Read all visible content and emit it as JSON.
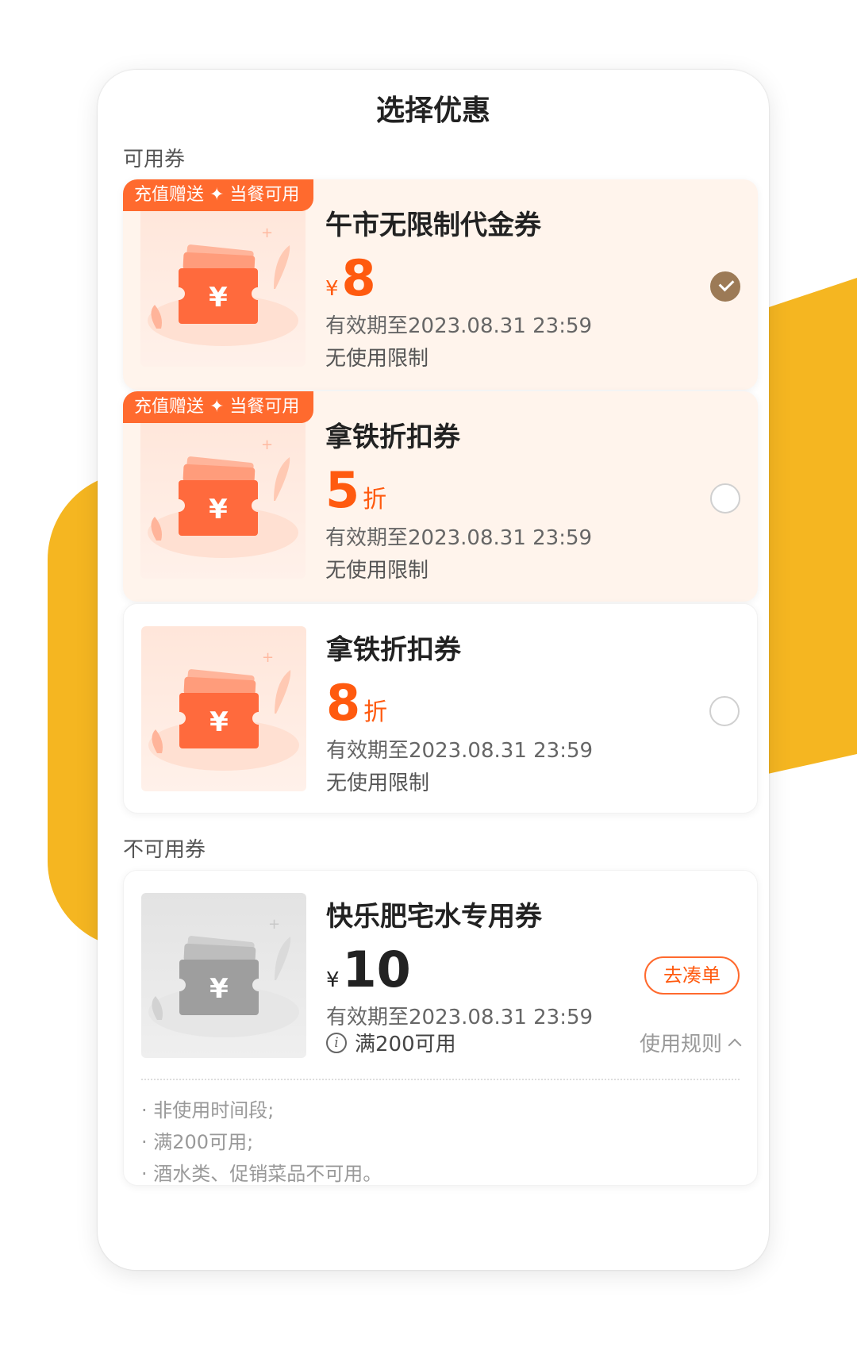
{
  "page": {
    "title": "选择优惠"
  },
  "available_section": {
    "label": "可用券",
    "coupons": [
      {
        "tag": "充值赠送 ✦ 当餐可用",
        "title": "午市无限制代金券",
        "currency": "¥",
        "amount": "8",
        "unit": "",
        "expire": "有效期至2023.08.31 23:59",
        "limit": "无使用限制",
        "selected": true
      },
      {
        "tag": "充值赠送 ✦ 当餐可用",
        "title": "拿铁折扣券",
        "currency": "",
        "amount": "5",
        "unit": "折",
        "expire": "有效期至2023.08.31 23:59",
        "limit": "无使用限制",
        "selected": false
      },
      {
        "tag": "",
        "title": "拿铁折扣券",
        "currency": "",
        "amount": "8",
        "unit": "折",
        "expire": "有效期至2023.08.31 23:59",
        "limit": "无使用限制",
        "selected": false
      }
    ]
  },
  "unavailable_section": {
    "label": "不可用券",
    "coupon": {
      "title": "快乐肥宅水专用券",
      "currency": "¥",
      "amount": "10",
      "expire": "有效期至2023.08.31 23:59",
      "condition": "满200可用",
      "action_label": "去凑单",
      "rules_label": "使用规则",
      "rules": [
        "非使用时间段;",
        "满200可用;",
        "酒水类、促销菜品不可用。"
      ]
    }
  },
  "colors": {
    "accent": "#FF5A0F",
    "tag_bg": "#FF6A2E",
    "selected_radio": "#9C7A56",
    "deco_yellow": "#F5B621"
  },
  "icons": {
    "coupon_illustration": "wallet-yen-icon",
    "check": "check-icon",
    "info": "info-icon",
    "chevron": "chevron-up-icon"
  }
}
